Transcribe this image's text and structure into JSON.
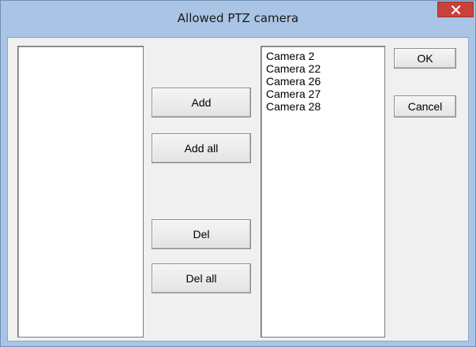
{
  "window": {
    "title": "Allowed PTZ camera",
    "close_icon": "close-icon"
  },
  "available_list": {
    "items": []
  },
  "allowed_list": {
    "items": [
      "Camera 2",
      "Camera 22",
      "Camera 26",
      "Camera 27",
      "Camera 28"
    ]
  },
  "buttons": {
    "add": "Add",
    "add_all": "Add all",
    "del": "Del",
    "del_all": "Del all",
    "ok": "OK",
    "cancel": "Cancel"
  },
  "colors": {
    "titlebar": "#a9c4e4",
    "close_button": "#c7433a",
    "client_background": "#f0f0f0"
  }
}
